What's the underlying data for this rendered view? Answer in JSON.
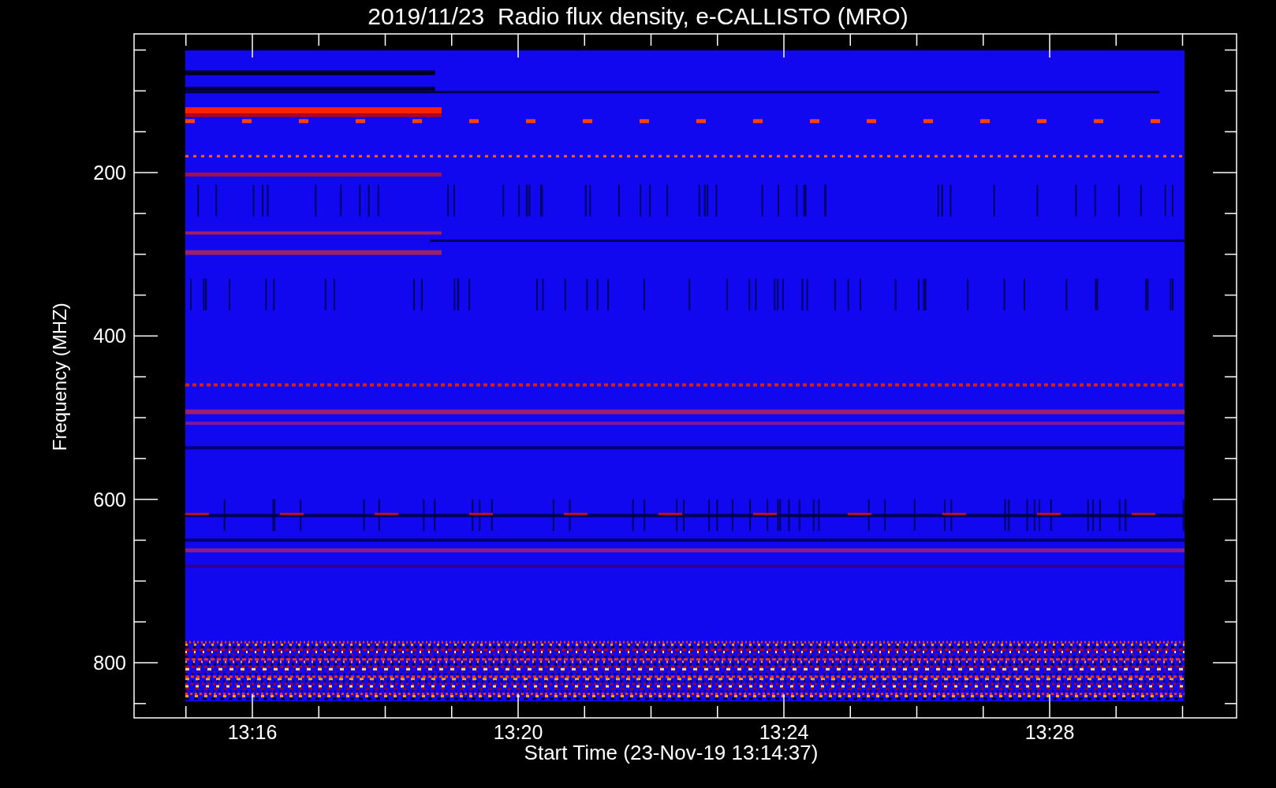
{
  "title": "2019/11/23  Radio flux density, e-CALLISTO (MRO)",
  "plot": {
    "ylabel": "Frequency (MHZ)",
    "yticks": [
      "200",
      "400",
      "600",
      "800"
    ],
    "xticks": [
      "13:16",
      "13:20",
      "13:24",
      "13:28"
    ],
    "xlabel": "Start Time (23-Nov-19 13:14:37)"
  }
}
